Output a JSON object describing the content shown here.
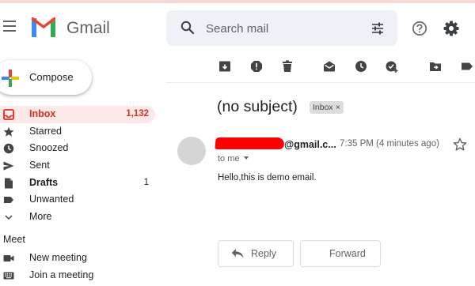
{
  "app": {
    "name": "Gmail"
  },
  "search": {
    "placeholder": "Search mail"
  },
  "compose": {
    "label": "Compose"
  },
  "nav": [
    {
      "label": "Inbox",
      "count": "1,132",
      "icon": "inbox-icon"
    },
    {
      "label": "Starred",
      "count": "",
      "icon": "star-icon"
    },
    {
      "label": "Snoozed",
      "count": "",
      "icon": "clock-icon"
    },
    {
      "label": "Sent",
      "count": "",
      "icon": "send-icon"
    },
    {
      "label": "Drafts",
      "count": "1",
      "icon": "draft-icon"
    },
    {
      "label": "Unwanted",
      "count": "",
      "icon": "label-icon"
    },
    {
      "label": "More",
      "count": "",
      "icon": "chevron-down-icon"
    }
  ],
  "meet": {
    "heading": "Meet",
    "items": [
      {
        "label": "New meeting",
        "icon": "video-icon"
      },
      {
        "label": "Join a meeting",
        "icon": "keyboard-icon"
      }
    ]
  },
  "toolbar": {
    "icons": [
      "archive-icon",
      "report-spam-icon",
      "delete-icon",
      "mark-unread-icon",
      "snooze-icon",
      "add-task-icon",
      "move-to-icon",
      "labels-icon"
    ]
  },
  "message": {
    "subject": "(no subject)",
    "label": "Inbox",
    "label_close": "×",
    "sender": "@gmail.c...",
    "time": "7:35 PM (4 minutes ago)",
    "to": "to me",
    "body": "Hello,this is demo email."
  },
  "actions": {
    "reply": "Reply",
    "forward": "Forward"
  },
  "colors": {
    "accent_red": "#d93025",
    "active_bg": "#fce8e6",
    "icon_gray": "#5f6368",
    "search_bg": "#eef1f5",
    "redaction": "#ff0000"
  }
}
